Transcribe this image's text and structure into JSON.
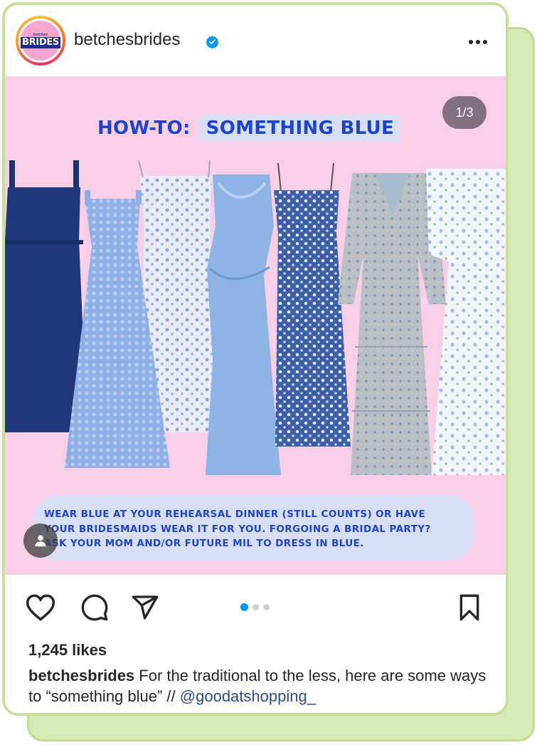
{
  "post": {
    "username": "betchesbrides",
    "verified": true,
    "avatar_logo_small": "betches",
    "avatar_logo_text": "BRIDES",
    "image": {
      "title_prefix": "HOW-TO:",
      "title_highlight": "SOMETHING BLUE",
      "page_counter": "1/3",
      "caption_lines": [
        "WEAR BLUE AT YOUR REHEARSAL DINNER (STILL COUNTS) OR HAVE",
        "YOUR BRIDESMAIDS WEAR IT FOR YOU. FORGOING A BRIDAL PARTY?",
        "ASK YOUR MOM AND/OR FUTURE MIL TO DRESS IN BLUE."
      ],
      "background_color": "#f8cfe6",
      "accent_color": "#1f44cc"
    },
    "carousel": {
      "current": 1,
      "total": 3
    },
    "likes": "1,245 likes",
    "caption": {
      "user": "betchesbrides",
      "text": "For the traditional to the less, here are some ways to “something blue” // ",
      "mention": "@goodatshopping_"
    },
    "icons": {
      "like": "heart-icon",
      "comment": "comment-icon",
      "share": "send-icon",
      "save": "bookmark-icon",
      "more": "more-icon",
      "tag": "user-tag-icon"
    },
    "colors": {
      "frame_green": "#c6e29a",
      "link_blue": "#0095f6"
    }
  }
}
